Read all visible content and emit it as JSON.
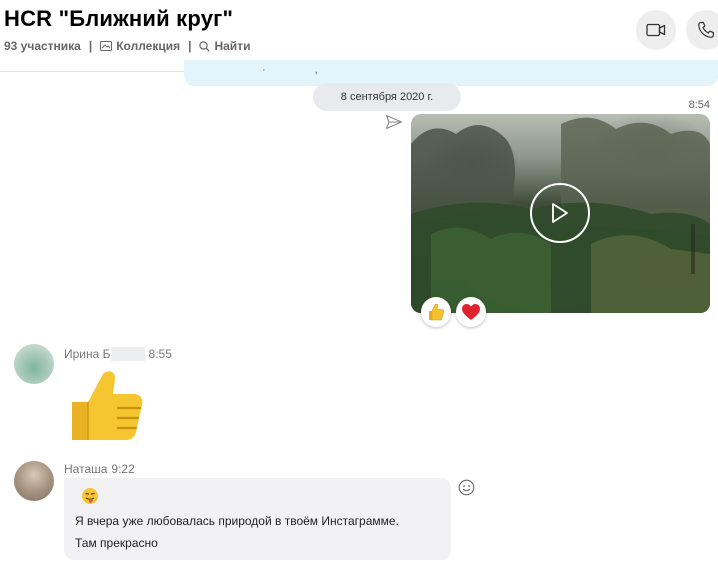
{
  "header": {
    "title": "HCR \"Ближний круг\"",
    "members": "93 участника",
    "separator": "|",
    "collection": "Коллекция",
    "find": "Найти",
    "video_call_icon": "video-camera-icon",
    "audio_call_icon": "phone-icon"
  },
  "chat": {
    "date_divider": "8 сентября 2020 г.",
    "my_message": {
      "time": "8:54",
      "status_icon": "sent-icon",
      "attachment": "video",
      "reactions": [
        "thumbs-up",
        "heart"
      ]
    },
    "messages": [
      {
        "sender": "Ирина Б",
        "time": "8:55",
        "content": "thumbs-up-emoji"
      },
      {
        "sender": "Наташа",
        "time": "9:22",
        "emoji": "tongue-face",
        "line1": "Я вчера уже любовалась природой в твоём Инстаграмме.",
        "line2": "Там прекрасно"
      }
    ]
  },
  "colors": {
    "accent_blue_bubble": "#e3f5fb",
    "incoming_bubble": "#f2f2f4",
    "heart": "#e0242f",
    "thumb": "#f5c22f"
  }
}
